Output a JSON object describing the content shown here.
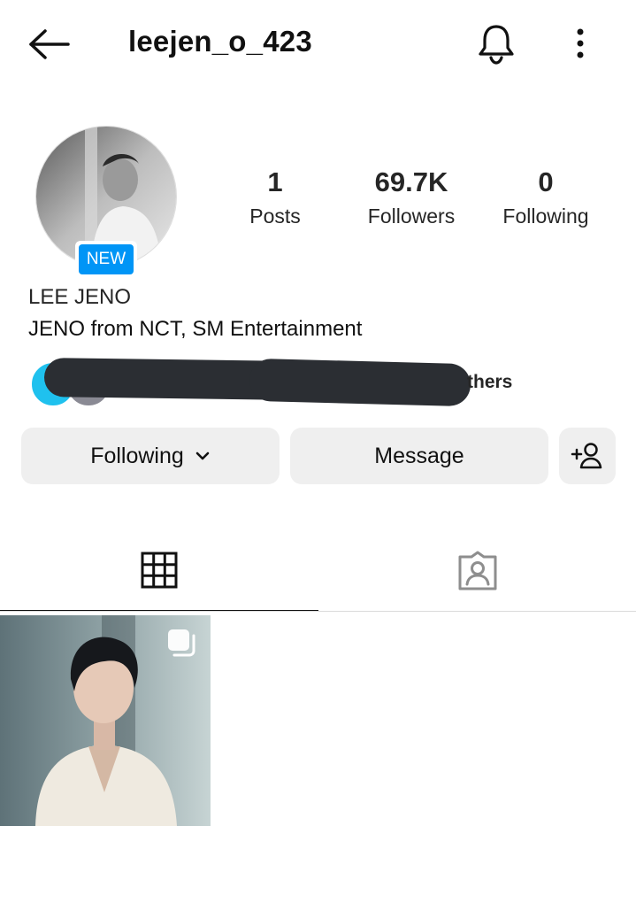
{
  "header": {
    "username": "leejen_o_423",
    "back_icon": "arrow-left-icon",
    "notify_icon": "bell-icon",
    "more_icon": "more-vertical-icon"
  },
  "profile": {
    "new_badge": "NEW",
    "full_name": "LEE JENO",
    "bio": "JENO from NCT, SM Entertainment",
    "followed_by_visible_text": "thers"
  },
  "stats": {
    "posts": {
      "value": "1",
      "label": "Posts"
    },
    "followers": {
      "value": "69.7K",
      "label": "Followers"
    },
    "following": {
      "value": "0",
      "label": "Following"
    }
  },
  "actions": {
    "following_label": "Following",
    "message_label": "Message",
    "add_user_icon": "add-user-icon"
  },
  "tabs": {
    "grid_icon": "grid-icon",
    "tagged_icon": "tagged-person-icon",
    "active": "grid"
  },
  "colors": {
    "accent": "#0095f6",
    "button_bg": "#efefef",
    "text": "#262626"
  }
}
